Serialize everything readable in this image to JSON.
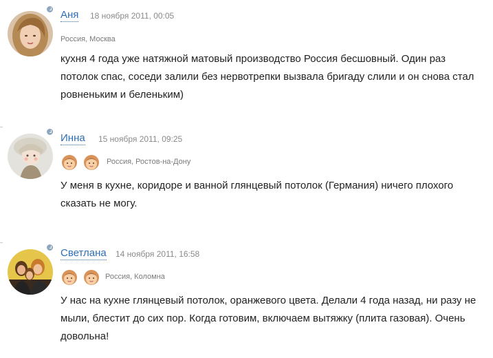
{
  "comments": [
    {
      "author": "Аня",
      "date": "18 ноября 2011, 00:05",
      "location": "Россия, Москва",
      "badges": [],
      "text": "кухня 4 года уже натяжной матовый производство Россия бесшовный. Один раз потолок спас, соседи залили без нервотрепки вызвала бригаду слили и он снова стал ровненьким и беленьким)"
    },
    {
      "author": "Инна",
      "date": "15 ноября 2011, 09:25",
      "location": "Россия, Ростов-на-Дону",
      "badges": [
        "girl-face-icon",
        "girl-face-icon"
      ],
      "text": "У меня в кухне, коридоре и ванной глянцевый потолок (Германия) ничего плохого сказать не могу."
    },
    {
      "author": "Светлана",
      "date": "14 ноября 2011, 16:58",
      "location": "Россия, Коломна",
      "badges": [
        "girl-face-icon",
        "girl-face-icon"
      ],
      "text": "У нас на кухне глянцевый потолок, оранжевого цвета. Делали 4 года назад, ни разу не мыли, блестит до сих пор. Когда готовим, включаем вытяжку (плита газовая). Очень довольна!"
    }
  ],
  "colors": {
    "author_link": "#2e6fb5",
    "meta_text": "#8a8a8a",
    "body_text": "#222222"
  }
}
